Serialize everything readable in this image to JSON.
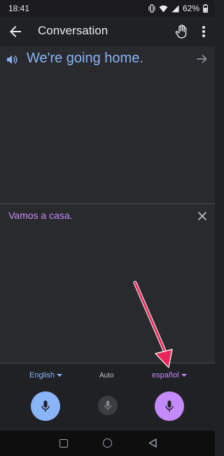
{
  "status_bar": {
    "time": "18:41",
    "battery": "62%",
    "icons": [
      "vibrate-icon",
      "wifi-icon",
      "signal-icon",
      "battery-icon"
    ]
  },
  "app_bar": {
    "title": "Conversation",
    "icons": [
      "back-arrow-icon",
      "hand-icon",
      "more-vert-icon"
    ]
  },
  "source_panel": {
    "text": "We're going home.",
    "icons": [
      "speaker-icon",
      "arrow-right-icon"
    ]
  },
  "target_panel": {
    "text": "Vamos a casa.",
    "icons": [
      "close-icon"
    ]
  },
  "controls": {
    "left_language": "English",
    "middle_label": "Auto",
    "right_language": "español",
    "icons": [
      "mic-icon",
      "mic-auto-icon",
      "mic-icon"
    ]
  },
  "colors": {
    "background": "#202124",
    "panel": "#292a2d",
    "english_accent": "#8ab4f8",
    "spanish_accent": "#c58af9",
    "annotation_arrow": "#e8265a"
  },
  "nav_bar": {
    "icons": [
      "recents-square-icon",
      "home-circle-icon",
      "back-triangle-icon"
    ]
  }
}
